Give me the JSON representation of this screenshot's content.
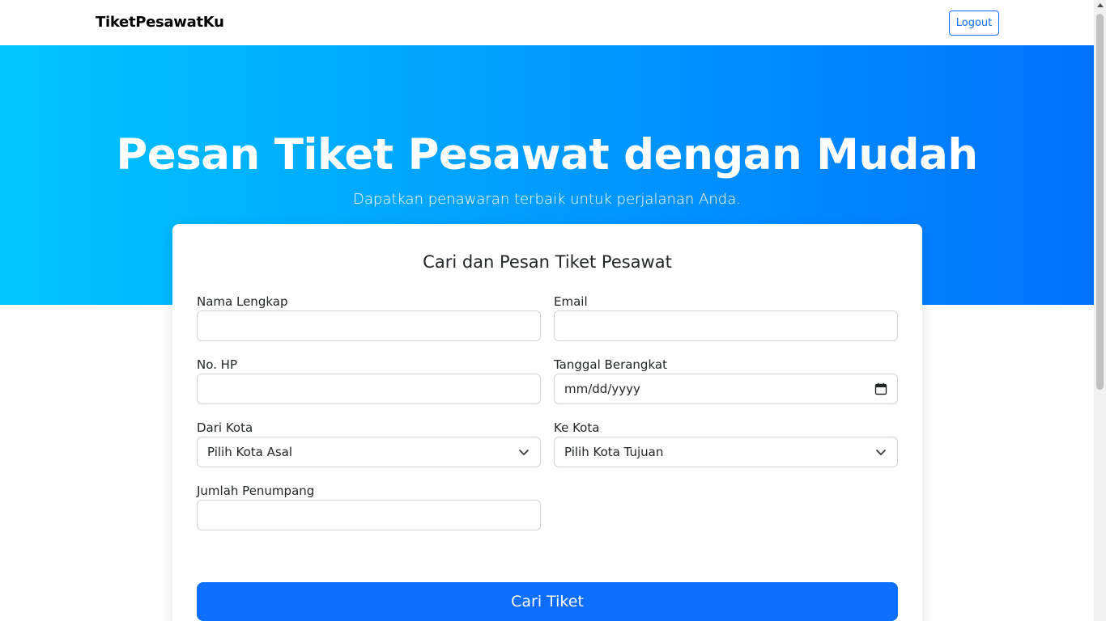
{
  "navbar": {
    "brand": "TiketPesawatKu",
    "logout_label": "Logout"
  },
  "hero": {
    "title": "Pesan Tiket Pesawat dengan Mudah",
    "subtitle": "Dapatkan penawaran terbaik untuk perjalanan Anda."
  },
  "form": {
    "title": "Cari dan Pesan Tiket Pesawat",
    "fields": {
      "nama": {
        "label": "Nama Lengkap",
        "value": ""
      },
      "email": {
        "label": "Email",
        "value": ""
      },
      "hp": {
        "label": "No. HP",
        "value": ""
      },
      "tanggal": {
        "label": "Tanggal Berangkat",
        "value": "mm/dd/yyyy"
      },
      "dari": {
        "label": "Dari Kota",
        "value": "Pilih Kota Asal"
      },
      "ke": {
        "label": "Ke Kota",
        "value": "Pilih Kota Tujuan"
      },
      "jumlah": {
        "label": "Jumlah Penumpang",
        "value": ""
      }
    },
    "submit_label": "Cari Tiket"
  },
  "icons": {
    "date": "calendar-icon",
    "select": "chevron-down-icon"
  },
  "colors": {
    "primary": "#0d6efd",
    "hero_gradient_start": "#00c6ff",
    "hero_gradient_end": "#0072ff"
  }
}
